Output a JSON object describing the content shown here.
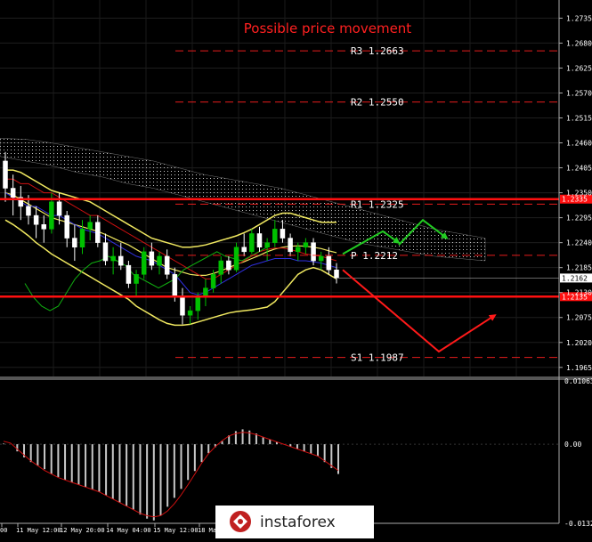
{
  "chart_data": [
    {
      "type": "candlestick",
      "title": "Possible price movement",
      "ylim": [
        1.1945,
        1.2775
      ],
      "y_ticks": [
        "1.2735",
        "1.2680",
        "1.2625",
        "1.2570",
        "1.2515",
        "1.2460",
        "1.2405",
        "1.2350",
        "1.2295",
        "1.2240",
        "1.2185",
        "1.2130",
        "1.2075",
        "1.2020",
        "1.1965"
      ],
      "current_price": "1.2162",
      "horizontal_lines": {
        "support_line_price": "1.2135",
        "resistance_line_price": "1.2335",
        "support_line_value": 1.2121,
        "resistance_line_value": 1.2336
      },
      "pivot_levels": [
        {
          "label": "R3 1.2663",
          "value": 1.2663
        },
        {
          "label": "R2 1.2550",
          "value": 1.255
        },
        {
          "label": "R1 1.2325",
          "value": 1.2325
        },
        {
          "label": "P 1.2212",
          "value": 1.2212
        },
        {
          "label": "S1 1.1987",
          "value": 1.1987
        }
      ],
      "ohlc": [
        [
          1.242,
          1.244,
          1.233,
          1.236
        ],
        [
          1.236,
          1.239,
          1.23,
          1.234
        ],
        [
          1.234,
          1.2365,
          1.229,
          1.232
        ],
        [
          1.232,
          1.2345,
          1.228,
          1.23
        ],
        [
          1.23,
          1.232,
          1.225,
          1.228
        ],
        [
          1.228,
          1.23,
          1.224,
          1.227
        ],
        [
          1.227,
          1.235,
          1.226,
          1.233
        ],
        [
          1.233,
          1.235,
          1.228,
          1.23
        ],
        [
          1.23,
          1.231,
          1.223,
          1.225
        ],
        [
          1.225,
          1.228,
          1.22,
          1.223
        ],
        [
          1.223,
          1.229,
          1.2215,
          1.227
        ],
        [
          1.227,
          1.23,
          1.2245,
          1.2285
        ],
        [
          1.2285,
          1.23,
          1.223,
          1.224
        ],
        [
          1.224,
          1.226,
          1.219,
          1.22
        ],
        [
          1.22,
          1.223,
          1.217,
          1.221
        ],
        [
          1.221,
          1.224,
          1.218,
          1.219
        ],
        [
          1.219,
          1.22,
          1.214,
          1.215
        ],
        [
          1.215,
          1.218,
          1.212,
          1.217
        ],
        [
          1.217,
          1.223,
          1.216,
          1.222
        ],
        [
          1.222,
          1.224,
          1.218,
          1.219
        ],
        [
          1.219,
          1.222,
          1.217,
          1.221
        ],
        [
          1.221,
          1.2225,
          1.216,
          1.217
        ],
        [
          1.217,
          1.2185,
          1.211,
          1.212
        ],
        [
          1.212,
          1.214,
          1.206,
          1.208
        ],
        [
          1.208,
          1.21,
          1.206,
          1.209
        ],
        [
          1.209,
          1.213,
          1.207,
          1.212
        ],
        [
          1.212,
          1.216,
          1.21,
          1.214
        ],
        [
          1.214,
          1.218,
          1.213,
          1.217
        ],
        [
          1.217,
          1.221,
          1.215,
          1.22
        ],
        [
          1.22,
          1.221,
          1.217,
          1.218
        ],
        [
          1.218,
          1.224,
          1.2175,
          1.223
        ],
        [
          1.223,
          1.226,
          1.221,
          1.222
        ],
        [
          1.222,
          1.227,
          1.2215,
          1.226
        ],
        [
          1.226,
          1.2275,
          1.222,
          1.223
        ],
        [
          1.223,
          1.225,
          1.22,
          1.224
        ],
        [
          1.224,
          1.229,
          1.223,
          1.227
        ],
        [
          1.227,
          1.229,
          1.224,
          1.225
        ],
        [
          1.225,
          1.226,
          1.221,
          1.222
        ],
        [
          1.222,
          1.224,
          1.22,
          1.223
        ],
        [
          1.223,
          1.225,
          1.2215,
          1.224
        ],
        [
          1.224,
          1.225,
          1.219,
          1.22
        ],
        [
          1.22,
          1.222,
          1.218,
          1.221
        ],
        [
          1.221,
          1.223,
          1.217,
          1.218
        ],
        [
          1.218,
          1.2195,
          1.215,
          1.2162
        ]
      ],
      "bollinger_upper": [
        1.24,
        1.24,
        1.2395,
        1.2385,
        1.2375,
        1.2365,
        1.2355,
        1.235,
        1.2345,
        1.234,
        1.2335,
        1.233,
        1.232,
        1.231,
        1.23,
        1.229,
        1.228,
        1.227,
        1.226,
        1.225,
        1.2245,
        1.224,
        1.2235,
        1.223,
        1.223,
        1.2232,
        1.2235,
        1.224,
        1.2245,
        1.225,
        1.2255,
        1.2262,
        1.227,
        1.228,
        1.229,
        1.23,
        1.2305,
        1.2305,
        1.23,
        1.2295,
        1.229,
        1.2285,
        1.2285,
        1.2285
      ],
      "bollinger_mid": [
        1.235,
        1.2345,
        1.2335,
        1.2325,
        1.2315,
        1.2305,
        1.2295,
        1.229,
        1.2285,
        1.228,
        1.2275,
        1.227,
        1.2265,
        1.2258,
        1.225,
        1.2242,
        1.2235,
        1.2225,
        1.2215,
        1.2205,
        1.2195,
        1.2185,
        1.218,
        1.2175,
        1.217,
        1.2168,
        1.2168,
        1.2172,
        1.2178,
        1.2185,
        1.2192,
        1.2198,
        1.2205,
        1.2212,
        1.222,
        1.2226,
        1.223,
        1.2232,
        1.2233,
        1.2232,
        1.223,
        1.2227,
        1.2222,
        1.2218
      ],
      "bollinger_lower": [
        1.229,
        1.228,
        1.2268,
        1.2255,
        1.224,
        1.2228,
        1.2215,
        1.2205,
        1.2195,
        1.2185,
        1.2175,
        1.2165,
        1.2155,
        1.2145,
        1.2135,
        1.2125,
        1.2115,
        1.21,
        1.209,
        1.208,
        1.207,
        1.2062,
        1.2058,
        1.2058,
        1.206,
        1.2065,
        1.207,
        1.2075,
        1.208,
        1.2085,
        1.2088,
        1.209,
        1.2092,
        1.2095,
        1.2098,
        1.211,
        1.213,
        1.215,
        1.217,
        1.218,
        1.2185,
        1.218,
        1.217,
        1.216
      ],
      "kijun": [
        1.238,
        1.238,
        1.237,
        1.237,
        1.236,
        1.235,
        1.235,
        1.234,
        1.233,
        1.232,
        1.231,
        1.23,
        1.23,
        1.229,
        1.228,
        1.227,
        1.226,
        1.225,
        1.224,
        1.223,
        1.222,
        1.221,
        1.22,
        1.219,
        1.218,
        1.217,
        1.216,
        1.216,
        1.217,
        1.218,
        1.219,
        1.22,
        1.221,
        1.222,
        1.2225,
        1.2228,
        1.2228,
        1.2225,
        1.222,
        1.2215,
        1.2212,
        1.221,
        1.2205,
        1.22
      ],
      "tenkan": [
        1.235,
        1.234,
        1.233,
        1.232,
        1.232,
        1.231,
        1.23,
        1.23,
        1.229,
        1.228,
        1.227,
        1.2265,
        1.226,
        1.225,
        1.224,
        1.223,
        1.222,
        1.221,
        1.2205,
        1.22,
        1.219,
        1.218,
        1.217,
        1.215,
        1.213,
        1.2125,
        1.213,
        1.214,
        1.215,
        1.216,
        1.217,
        1.218,
        1.219,
        1.2195,
        1.22,
        1.2205,
        1.2205,
        1.2205,
        1.22,
        1.22,
        1.2198,
        1.2195,
        1.219,
        1.2185
      ],
      "chikou": [
        1.215,
        1.212,
        1.21,
        1.209,
        1.21,
        1.213,
        1.216,
        1.218,
        1.2195,
        1.22,
        1.221,
        1.22,
        1.219,
        1.217,
        1.216,
        1.215,
        1.214,
        1.215,
        1.216,
        1.218,
        1.219,
        1.22,
        1.221,
        1.222,
        1.221,
        1.2205,
        1.22,
        1.221,
        1.222,
        1.223
      ],
      "forecast_paths": [
        {
          "color": "#ff1a1a",
          "points": [
            [
              1.218,
              0
            ],
            [
              1.2,
              12
            ],
            [
              1.208,
              19
            ]
          ]
        },
        {
          "color": "#22cc22",
          "points": [
            [
              1.2215,
              0
            ],
            [
              1.2265,
              5
            ],
            [
              1.224,
              7
            ]
          ]
        },
        {
          "color": "#22cc22",
          "points": [
            [
              1.2235,
              7
            ],
            [
              1.229,
              10
            ],
            [
              1.225,
              13
            ]
          ]
        }
      ],
      "histogram": [
        0.0001,
        0.0,
        -0.0012,
        -0.0022,
        -0.003,
        -0.0036,
        -0.0042,
        -0.005,
        -0.0055,
        -0.006,
        -0.0064,
        -0.0068,
        -0.0072,
        -0.0076,
        -0.008,
        -0.0086,
        -0.0092,
        -0.0098,
        -0.0104,
        -0.011,
        -0.0118,
        -0.0125,
        -0.0128,
        -0.012,
        -0.0105,
        -0.009,
        -0.0075,
        -0.006,
        -0.0045,
        -0.003,
        -0.0015,
        -0.0005,
        0.0005,
        0.0015,
        0.0022,
        0.0025,
        0.0023,
        0.0018,
        0.0012,
        0.0008,
        0.0004,
        0.0,
        -0.0004,
        -0.0008,
        -0.0012,
        -0.0016,
        -0.002,
        -0.003,
        -0.004,
        -0.005
      ],
      "signal": [
        0.0005,
        0.0002,
        -0.0008,
        -0.0018,
        -0.0028,
        -0.0036,
        -0.0044,
        -0.005,
        -0.0056,
        -0.006,
        -0.0064,
        -0.0068,
        -0.0072,
        -0.0076,
        -0.008,
        -0.0086,
        -0.0092,
        -0.0098,
        -0.0104,
        -0.011,
        -0.0116,
        -0.012,
        -0.0122,
        -0.012,
        -0.0112,
        -0.01,
        -0.0085,
        -0.0068,
        -0.005,
        -0.0032,
        -0.0016,
        -0.0004,
        0.0006,
        0.0014,
        0.0018,
        0.002,
        0.0019,
        0.0016,
        0.0012,
        0.0008,
        0.0004,
        0.0,
        -0.0004,
        -0.0008,
        -0.0012,
        -0.0016,
        -0.002,
        -0.0028,
        -0.0036,
        -0.0044
      ],
      "osc_ticks": [
        "0.01063",
        "0.00",
        "-0.01328"
      ],
      "osc_ylim": [
        -0.01328,
        0.01063
      ],
      "x_labels": [
        "00",
        "11 May 12:00",
        "12 May 20:00",
        "14 May 04:00",
        "15 May 12:00",
        "18 Ma"
      ],
      "watermark": "instaforex",
      "colors": {
        "background": "#000000",
        "bull": "#00c000",
        "bear": "#ffffff",
        "bollinger": "#f0e860",
        "kijun": "#d01010",
        "tenkan": "#3030e0",
        "chikou": "#10b010",
        "cloud": "#ffffff",
        "title": "#ff2020",
        "level_line": "#ff2020",
        "histogram": "#c8c8c8",
        "signal": "#d01010",
        "axis_text": "#ffffff"
      }
    }
  ]
}
